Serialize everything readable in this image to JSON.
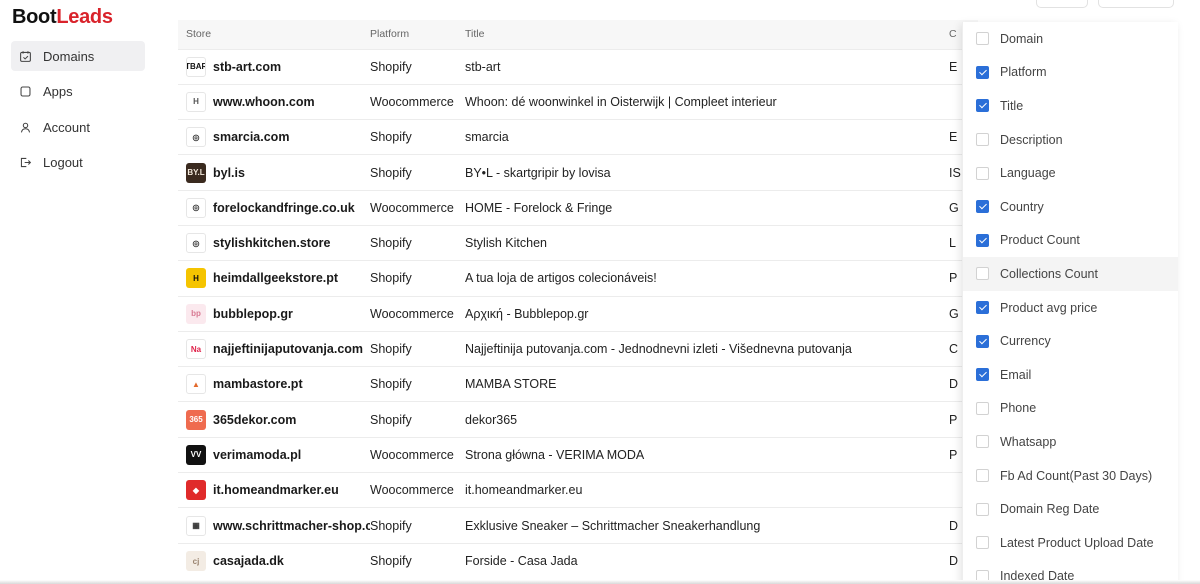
{
  "brand": {
    "part1": "Boot",
    "part2": "Leads",
    "accent": "#d9232b"
  },
  "sidebar": {
    "items": [
      {
        "label": "Domains",
        "icon": "domains-icon",
        "active": true
      },
      {
        "label": "Apps",
        "icon": "apps-icon",
        "active": false
      },
      {
        "label": "Account",
        "icon": "user-icon",
        "active": false
      },
      {
        "label": "Logout",
        "icon": "logout-icon",
        "active": false
      }
    ]
  },
  "table": {
    "columns": [
      "Store",
      "Platform",
      "Title",
      "C"
    ],
    "rows": [
      {
        "store": "stb-art.com",
        "platform": "Shopify",
        "title": "stb-art",
        "extra": "E"
      },
      {
        "store": "www.whoon.com",
        "platform": "Woocommerce",
        "title": "Whoon: dé woonwinkel in Oisterwijk | Compleet interieur",
        "extra": ""
      },
      {
        "store": "smarcia.com",
        "platform": "Shopify",
        "title": "smarcia",
        "extra": "E"
      },
      {
        "store": "byl.is",
        "platform": "Shopify",
        "title": "BY•L - skartgripir by lovisa",
        "extra": "IS"
      },
      {
        "store": "forelockandfringe.co.uk",
        "platform": "Woocommerce",
        "title": "HOME - Forelock & Fringe",
        "extra": "G"
      },
      {
        "store": "stylishkitchen.store",
        "platform": "Shopify",
        "title": "Stylish Kitchen",
        "extra": "L"
      },
      {
        "store": "heimdallgeekstore.pt",
        "platform": "Shopify",
        "title": "A tua loja de artigos colecionáveis!",
        "extra": "P"
      },
      {
        "store": "bubblepop.gr",
        "platform": "Woocommerce",
        "title": "Αρχική - Bubblepop.gr",
        "extra": "G"
      },
      {
        "store": "najjeftinijaputovanja.com",
        "platform": "Shopify",
        "title": "Najjeftinija putovanja.com - Jednodnevni izleti - Višednevna putovanja",
        "extra": "C"
      },
      {
        "store": "mambastore.pt",
        "platform": "Shopify",
        "title": "MAMBA STORE",
        "extra": "D"
      },
      {
        "store": "365dekor.com",
        "platform": "Shopify",
        "title": "dekor365",
        "extra": "P"
      },
      {
        "store": "verimamoda.pl",
        "platform": "Woocommerce",
        "title": "Strona główna - VERIMA MODA",
        "extra": "P"
      },
      {
        "store": "it.homeandmarker.eu",
        "platform": "Woocommerce",
        "title": "it.homeandmarker.eu",
        "extra": ""
      },
      {
        "store": "www.schrittmacher-shop.com",
        "platform": "Shopify",
        "title": "Exklusive Sneaker – Schrittmacher Sneakerhandlung",
        "extra": "D"
      },
      {
        "store": "casajada.dk",
        "platform": "Shopify",
        "title": "Forside - Casa Jada",
        "extra": "D"
      }
    ]
  },
  "favicons": [
    {
      "text": "STBART",
      "bg": "#ffffff",
      "fg": "#111111"
    },
    {
      "text": "H",
      "bg": "#ffffff",
      "fg": "#555555"
    },
    {
      "text": "◎",
      "bg": "#ffffff",
      "fg": "#333333"
    },
    {
      "text": "BY.L",
      "bg": "#3a2a1f",
      "fg": "#f3e9dc"
    },
    {
      "text": "◎",
      "bg": "#ffffff",
      "fg": "#333333"
    },
    {
      "text": "◎",
      "bg": "#ffffff",
      "fg": "#333333"
    },
    {
      "text": "H",
      "bg": "#f5c400",
      "fg": "#111111"
    },
    {
      "text": "bp",
      "bg": "#fbe9ee",
      "fg": "#d87a93"
    },
    {
      "text": "Na",
      "bg": "#ffffff",
      "fg": "#e0224a"
    },
    {
      "text": "▲",
      "bg": "#ffffff",
      "fg": "#e36a2c"
    },
    {
      "text": "365",
      "bg": "#ef6b4f",
      "fg": "#ffffff"
    },
    {
      "text": "VV",
      "bg": "#111111",
      "fg": "#ffffff"
    },
    {
      "text": "◆",
      "bg": "#e02a2a",
      "fg": "#ffffff"
    },
    {
      "text": "▦",
      "bg": "#ffffff",
      "fg": "#333333"
    },
    {
      "text": "cj",
      "bg": "#f3ece4",
      "fg": "#9a8470"
    }
  ],
  "column_menu": {
    "highlight": "Collections Count",
    "check_color": "#2b6fd8",
    "items": [
      {
        "label": "Domain",
        "checked": false
      },
      {
        "label": "Platform",
        "checked": true
      },
      {
        "label": "Title",
        "checked": true
      },
      {
        "label": "Description",
        "checked": false
      },
      {
        "label": "Language",
        "checked": false
      },
      {
        "label": "Country",
        "checked": true
      },
      {
        "label": "Product Count",
        "checked": true
      },
      {
        "label": "Collections Count",
        "checked": false
      },
      {
        "label": "Product avg price",
        "checked": true
      },
      {
        "label": "Currency",
        "checked": true
      },
      {
        "label": "Email",
        "checked": true
      },
      {
        "label": "Phone",
        "checked": false
      },
      {
        "label": "Whatsapp",
        "checked": false
      },
      {
        "label": "Fb Ad Count(Past 30 Days)",
        "checked": false
      },
      {
        "label": "Domain Reg Date",
        "checked": false
      },
      {
        "label": "Latest Product Upload Date",
        "checked": false
      },
      {
        "label": "Indexed Date",
        "checked": false
      }
    ]
  }
}
